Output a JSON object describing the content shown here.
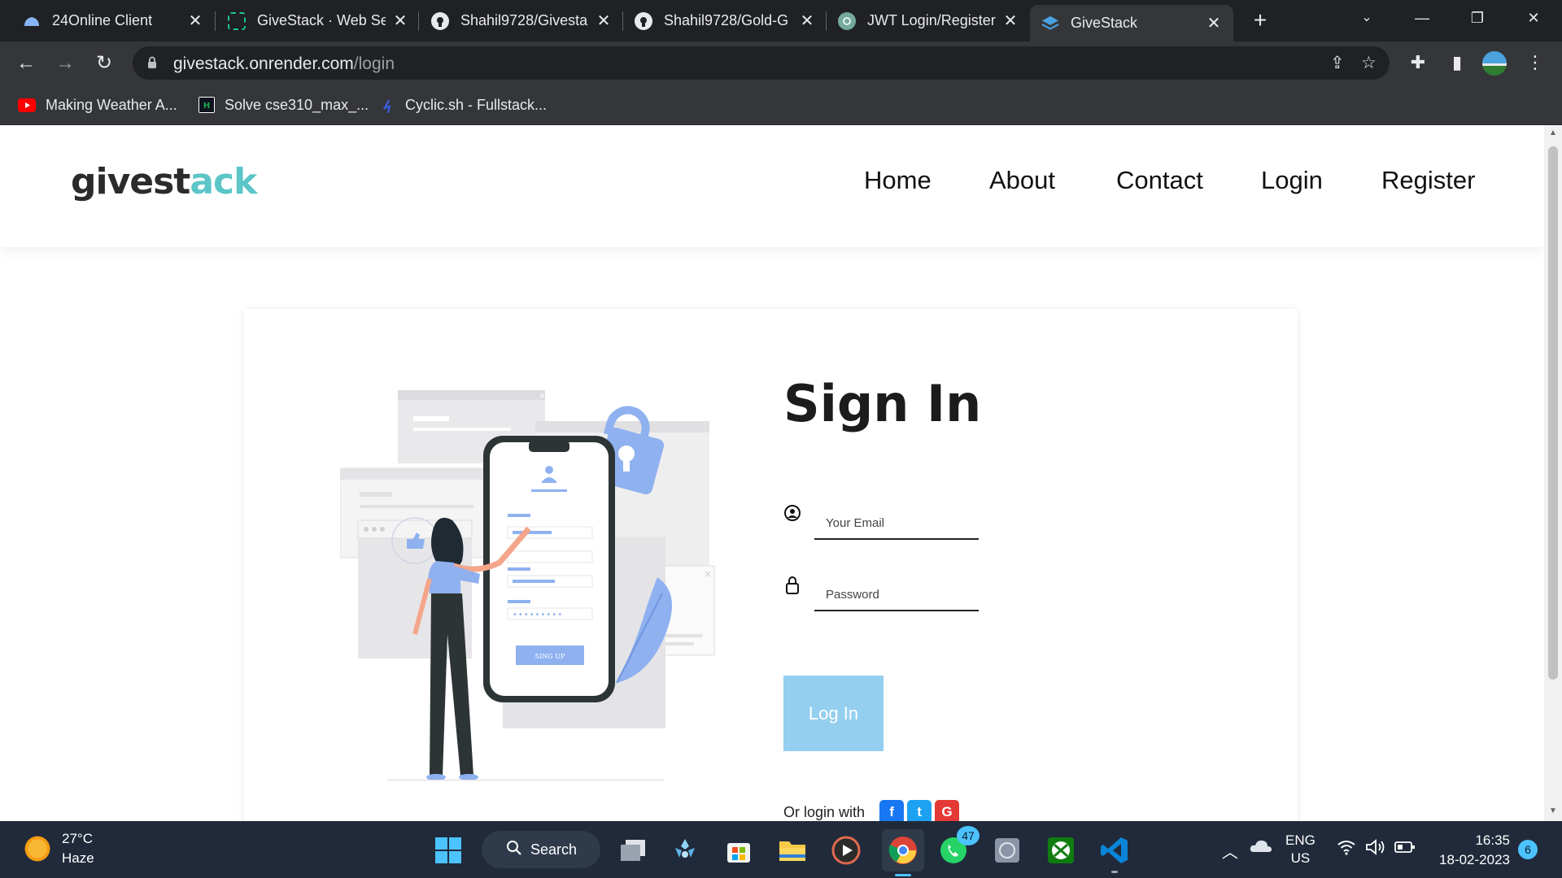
{
  "browser": {
    "tabs": [
      {
        "label": "24Online Client",
        "icon": "cloud-icon",
        "active": false
      },
      {
        "label": "GiveStack · Web Se",
        "icon": "giveStack-favicon",
        "active": false
      },
      {
        "label": "Shahil9728/Givesta",
        "icon": "github-icon",
        "active": false
      },
      {
        "label": "Shahil9728/Gold-G",
        "icon": "github-icon",
        "active": false
      },
      {
        "label": "JWT Login/Register",
        "icon": "chatgpt-icon",
        "active": false
      },
      {
        "label": "GiveStack",
        "icon": "givestack-favicon",
        "active": true
      }
    ],
    "url_host": "givestack.onrender.com",
    "url_path": "/login",
    "bookmarks": [
      {
        "label": "Making Weather A...",
        "icon": "youtube-icon"
      },
      {
        "label": "Solve cse310_max_...",
        "icon": "hackerrank-icon"
      },
      {
        "label": "Cyclic.sh - Fullstack...",
        "icon": "cyclic-icon"
      }
    ]
  },
  "site": {
    "logo_main": "givest",
    "logo_accent": "ack",
    "nav": [
      "Home",
      "About",
      "Contact",
      "Login",
      "Register"
    ]
  },
  "login": {
    "title": "Sign In",
    "email_placeholder": "Your Email",
    "password_placeholder": "Password",
    "button_label": "Log In",
    "social_label": "Or login with",
    "social": [
      {
        "label": "f",
        "name": "facebook",
        "color": "#1877f2"
      },
      {
        "label": "t",
        "name": "twitter",
        "color": "#1da1f2"
      },
      {
        "label": "G",
        "name": "google",
        "color": "#e53935"
      }
    ],
    "illustration_button": "SING UP"
  },
  "taskbar": {
    "temperature": "27°C",
    "weather": "Haze",
    "search_label": "Search",
    "whatsapp_badge": "47",
    "lang_line1": "ENG",
    "lang_line2": "US",
    "time": "16:35",
    "date": "18-02-2023",
    "notification_count": "6"
  },
  "colors": {
    "accent": "#5cc5c7",
    "button": "#94cff0",
    "illustration_blue": "#8fb1f0"
  }
}
